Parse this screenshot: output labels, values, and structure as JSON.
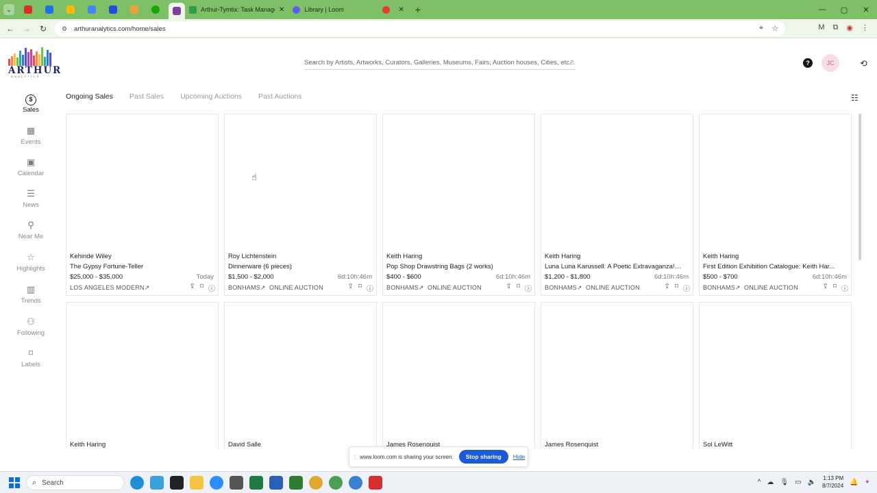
{
  "browser": {
    "tabs": [
      {
        "title": "Arthur-Tymtix: Task Manager -",
        "icon_color": "#2f9e44"
      },
      {
        "title": "Library | Loom",
        "icon_color": "#625df5"
      }
    ],
    "new_tab": "+",
    "url": "arthuranalytics.com/home/sales",
    "window_controls": {
      "minimize": "—",
      "maximize": "▢",
      "close": "✕"
    }
  },
  "header": {
    "logo_word": "ARTHUR",
    "logo_sub": "ANALYTICS",
    "search_placeholder": "Search by Artists, Artworks, Curators, Galleries, Museums, Fairs, Auction houses, Cities, etc...",
    "help": "?",
    "avatar": "JC"
  },
  "sidebar": {
    "items": [
      {
        "label": "Sales",
        "icon": "dollar-icon"
      },
      {
        "label": "Events",
        "icon": "events-icon"
      },
      {
        "label": "Calendar",
        "icon": "calendar-icon"
      },
      {
        "label": "News",
        "icon": "news-icon"
      },
      {
        "label": "Near Me",
        "icon": "location-icon"
      },
      {
        "label": "Highlights",
        "icon": "star-icon"
      },
      {
        "label": "Trends",
        "icon": "trends-icon"
      },
      {
        "label": "Following",
        "icon": "following-icon"
      },
      {
        "label": "Labels",
        "icon": "tag-icon"
      }
    ]
  },
  "subtabs": [
    "Ongoing Sales",
    "Past Sales",
    "Upcoming Auctions",
    "Past Auctions"
  ],
  "cards": [
    {
      "artist": "Kehinde Wiley",
      "title": "The Gypsy Fortune-Teller",
      "price": "$25,000 - $35,000",
      "time": "Today",
      "house": "LOS ANGELES MODERN↗",
      "type": ""
    },
    {
      "artist": "Roy Lichtenstein",
      "title": "Dinnerware (6 pieces)",
      "price": "$1,500 - $2,000",
      "time": "6d:10h:46m",
      "house": "BONHAMS↗",
      "type": "ONLINE AUCTION"
    },
    {
      "artist": "Keith Haring",
      "title": "Pop Shop Drawstring Bags (2 works)",
      "price": "$400 - $600",
      "time": "6d:10h:46m",
      "house": "BONHAMS↗",
      "type": "ONLINE AUCTION"
    },
    {
      "artist": "Keith Haring",
      "title": "Luna Luna Karussell: A Poetic Extravaganza!,...",
      "price": "$1,200 - $1,800",
      "time": "6d:10h:46m",
      "house": "BONHAMS↗",
      "type": "ONLINE AUCTION"
    },
    {
      "artist": "Keith Haring",
      "title": "First Edition Exhibition Catalogue: Keith Har...",
      "price": "$500 - $700",
      "time": "6d:10h:46m",
      "house": "BONHAMS↗",
      "type": "ONLINE AUCTION"
    }
  ],
  "cards_row2": [
    {
      "artist": "Keith Haring"
    },
    {
      "artist": "David Salle"
    },
    {
      "artist": "James Rosenquist"
    },
    {
      "artist": "James Rosenquist"
    },
    {
      "artist": "Sol LeWitt"
    }
  ],
  "loom": {
    "message": "www.loom.com is sharing your screen.",
    "stop": "Stop sharing",
    "hide": "Hide"
  },
  "taskbar": {
    "search": "Search",
    "time": "1:13 PM",
    "date": "8/7/2024"
  },
  "colors": {
    "tabbar": "#7ebf67",
    "accent": "#1b5bd6"
  }
}
